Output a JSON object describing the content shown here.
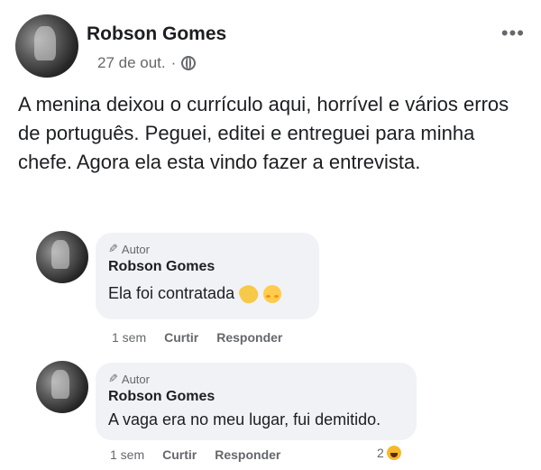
{
  "post": {
    "author": "Robson Gomes",
    "date": "27 de out.",
    "separator": "·",
    "more_icon": "•••",
    "text": "A menina deixou o currículo aqui, horrível e vários erros de português. Peguei, editei e entreguei para minha chefe. Agora ela esta vindo fazer a entrevista."
  },
  "comments": [
    {
      "badge": "Autor",
      "author": "Robson Gomes",
      "text": "Ela foi contratada",
      "emojis": [
        "clapping-hands-icon",
        "blush-icon"
      ],
      "time": "1 sem",
      "like": "Curtir",
      "reply": "Responder"
    },
    {
      "badge": "Autor",
      "author": "Robson Gomes",
      "text": "A vaga era no meu lugar, fui demitido.",
      "time": "1 sem",
      "like": "Curtir",
      "reply": "Responder",
      "reactions": {
        "count": "2",
        "icon": "haha-icon"
      }
    }
  ],
  "colors": {
    "secondary_text": "#65676b",
    "bubble_bg": "#f0f2f5"
  }
}
